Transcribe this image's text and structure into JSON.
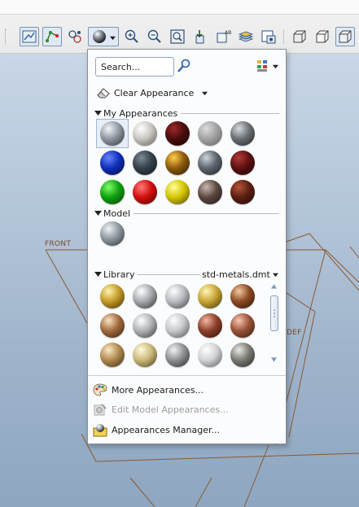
{
  "search": {
    "placeholder": "Search..."
  },
  "clear_appearance": {
    "label": "Clear Appearance"
  },
  "sections": {
    "my_appearances": "My Appearances",
    "model": "Model",
    "library": "Library"
  },
  "library_file": "std-metals.dmt",
  "my_appearances": [
    {
      "name": "silver-grey",
      "c1": "#f4f6f8",
      "c2": "#8f97a0",
      "c3": "#2f3338"
    },
    {
      "name": "pearl",
      "c1": "#ffffff",
      "c2": "#c9c6c0",
      "c3": "#5a5852"
    },
    {
      "name": "dark-red",
      "c1": "#9a2a2a",
      "c2": "#4a0c0c",
      "c3": "#170303"
    },
    {
      "name": "brushed-grey",
      "c1": "#dcdcdc",
      "c2": "#a3a3a3",
      "c3": "#5e5e5e"
    },
    {
      "name": "graphite",
      "c1": "#d9dcdf",
      "c2": "#6a6f74",
      "c3": "#1f2225"
    },
    {
      "name": "blue",
      "c1": "#6a85ff",
      "c2": "#0f2fb8",
      "c3": "#020a3e"
    },
    {
      "name": "dark-slate",
      "c1": "#7f8b93",
      "c2": "#34404a",
      "c3": "#0f161b"
    },
    {
      "name": "bronze",
      "c1": "#ffcf4a",
      "c2": "#8c5a0c",
      "c3": "#2b1703"
    },
    {
      "name": "steel",
      "c1": "#cfd5da",
      "c2": "#5c656d",
      "c3": "#1b2025"
    },
    {
      "name": "maroon",
      "c1": "#b53a3a",
      "c2": "#5b1111",
      "c3": "#1c0505"
    },
    {
      "name": "green",
      "c1": "#7cff6a",
      "c2": "#10a010",
      "c3": "#013d01"
    },
    {
      "name": "red",
      "c1": "#ff7a7a",
      "c2": "#d10e0e",
      "c3": "#4a0202"
    },
    {
      "name": "yellow",
      "c1": "#ffff9a",
      "c2": "#d4c500",
      "c3": "#4a4200"
    },
    {
      "name": "rock",
      "c1": "#c9b8b0",
      "c2": "#5a4740",
      "c3": "#1d1512"
    },
    {
      "name": "brick",
      "c1": "#b2563a",
      "c2": "#5d1f12",
      "c3": "#1e0904"
    }
  ],
  "model_appearances": [
    {
      "name": "default-grey",
      "c1": "#f0f3f6",
      "c2": "#8e979f",
      "c3": "#2d3237"
    }
  ],
  "library_appearances": [
    {
      "name": "gold",
      "c1": "#fff3b0",
      "c2": "#c29a26",
      "c3": "#3e2c05"
    },
    {
      "name": "chrome",
      "c1": "#ffffff",
      "c2": "#a5a9ad",
      "c3": "#2a2c2e"
    },
    {
      "name": "silver",
      "c1": "#ffffff",
      "c2": "#b7bbbf",
      "c3": "#3a3d40"
    },
    {
      "name": "brass",
      "c1": "#fff6b8",
      "c2": "#c7a534",
      "c3": "#3f3007"
    },
    {
      "name": "copper-dark",
      "c1": "#f5c8a2",
      "c2": "#8a4a22",
      "c3": "#2a1306"
    },
    {
      "name": "bronze-light",
      "c1": "#fbe3c6",
      "c2": "#a06a3c",
      "c3": "#331f0c"
    },
    {
      "name": "nickel",
      "c1": "#ffffff",
      "c2": "#b0b2b4",
      "c3": "#333537"
    },
    {
      "name": "platinum",
      "c1": "#ffffff",
      "c2": "#c5c7ca",
      "c3": "#4a4c4f"
    },
    {
      "name": "copper",
      "c1": "#f2b6a0",
      "c2": "#8c3f2a",
      "c3": "#2c0f07"
    },
    {
      "name": "rose-copper",
      "c1": "#f6c9b2",
      "c2": "#9a5238",
      "c3": "#30160b"
    },
    {
      "name": "antique-brass",
      "c1": "#fbe8c4",
      "c2": "#b08a4e",
      "c3": "#3a2810"
    },
    {
      "name": "pale-gold",
      "c1": "#fffbe0",
      "c2": "#cbb87a",
      "c3": "#463b18"
    },
    {
      "name": "steel-dark",
      "c1": "#f3f3f3",
      "c2": "#8e9092",
      "c3": "#252627"
    },
    {
      "name": "white-metal",
      "c1": "#ffffff",
      "c2": "#d2d3d4",
      "c3": "#55575a"
    },
    {
      "name": "gunmetal",
      "c1": "#e9e9e6",
      "c2": "#7b7b74",
      "c3": "#24241f"
    }
  ],
  "menu": {
    "more_appearances": "More Appearances...",
    "edit_model_appearances": "Edit Model Appearances...",
    "appearances_manager": "Appearances Manager..."
  },
  "viewport": {
    "front_label": "FRONT",
    "def_label": "DEF"
  },
  "colors": {
    "datum_line": "#8a5a32",
    "panel_bg": "#fbfcfd",
    "accent": "#9fb6d3"
  }
}
